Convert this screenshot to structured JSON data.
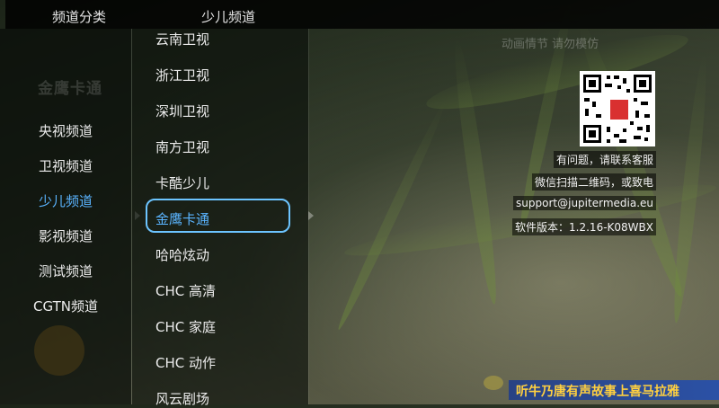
{
  "header": {
    "category_title": "频道分类",
    "current_category": "少儿频道"
  },
  "left_panel": {
    "logo_text": "金鹰卡通",
    "categories": [
      {
        "label": "央视频道",
        "active": false
      },
      {
        "label": "卫视频道",
        "active": false
      },
      {
        "label": "少儿频道",
        "active": true
      },
      {
        "label": "影视频道",
        "active": false
      },
      {
        "label": "测试频道",
        "active": false
      },
      {
        "label": "CGTN频道",
        "active": false
      }
    ]
  },
  "channel_list": {
    "items": [
      {
        "label": "云南卫视"
      },
      {
        "label": "浙江卫视"
      },
      {
        "label": "深圳卫视"
      },
      {
        "label": "南方卫视"
      },
      {
        "label": "卡酷少儿"
      },
      {
        "label": "金鹰卡通",
        "selected": true
      },
      {
        "label": "哈哈炫动"
      },
      {
        "label": "CHC 高清"
      },
      {
        "label": "CHC 家庭"
      },
      {
        "label": "CHC 动作"
      },
      {
        "label": "风云剧场"
      }
    ]
  },
  "overlay": {
    "program_hint": "动画情节 请勿模仿",
    "qr_icon": "qr-code-icon",
    "info_lines": [
      "有问题，请联系客服",
      "微信扫描二维码，或致电",
      "support@jupitermedia.eu",
      "软件版本：1.2.16-K08WBX"
    ]
  },
  "marquee": {
    "text": "听牛乃唐有声故事上喜马拉雅"
  },
  "colors": {
    "accent": "#5ab4ff",
    "focus_border": "#6cc4ff",
    "marquee_text": "#ffd040",
    "marquee_bg": "#2850aa"
  }
}
